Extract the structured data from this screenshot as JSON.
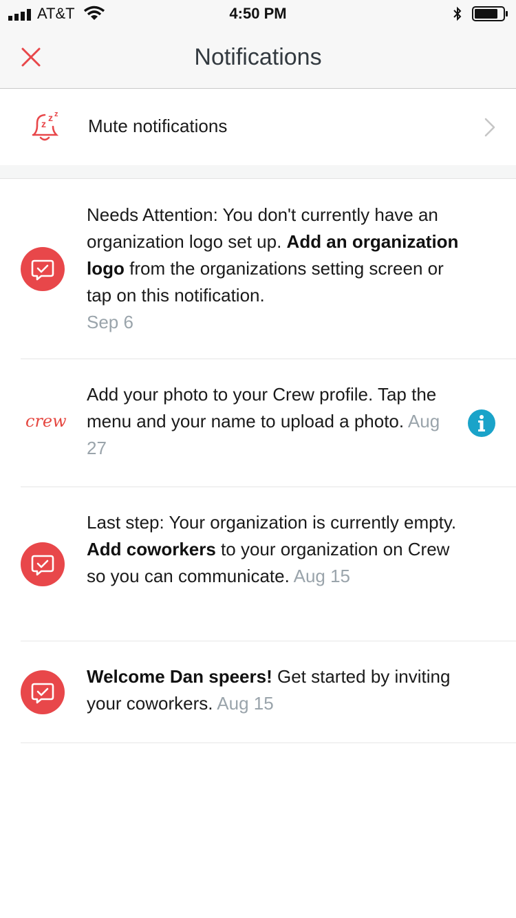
{
  "status_bar": {
    "carrier": "AT&T",
    "time": "4:50 PM"
  },
  "nav": {
    "title": "Notifications"
  },
  "mute": {
    "label": "Mute notifications",
    "icon": "bell-snooze-icon"
  },
  "notifications": [
    {
      "icon": "check-chat-icon",
      "pre": "Needs Attention: You don't currently have an organization logo set up. ",
      "bold": "Add an organization logo",
      "post": " from the organizations setting screen or tap on this notification.",
      "date": "Sep 6"
    },
    {
      "icon": "crew-logo",
      "logo_text": "crew",
      "text": "Add your photo to your Crew profile. Tap the menu and your name to upload a photo.",
      "date": "Aug 27",
      "action_icon": "info-icon"
    },
    {
      "icon": "check-chat-icon",
      "pre": "Last step: Your organization is currently empty. ",
      "bold": "Add coworkers",
      "post": " to your organization on Crew so you can communicate.",
      "date": "Aug 15"
    },
    {
      "icon": "check-chat-icon",
      "bold": "Welcome Dan speers!",
      "post": " Get started by inviting your coworkers.",
      "date": "Aug 15"
    }
  ],
  "colors": {
    "accent": "#e8474a",
    "date": "#9aa4ab",
    "info": "#1aa3c9"
  }
}
